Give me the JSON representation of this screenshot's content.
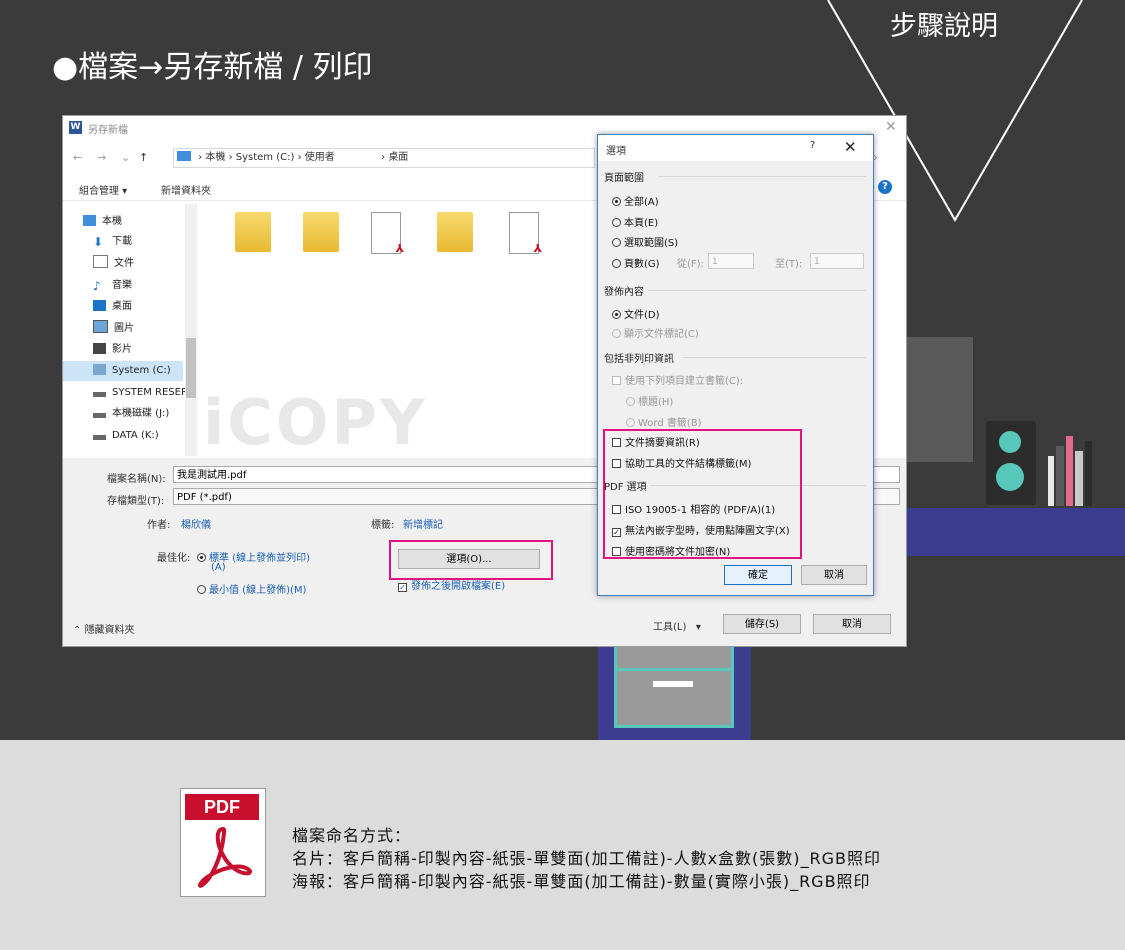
{
  "heading": "●檔案→另存新檔 / 列印",
  "step_label": "步驟說明",
  "save_window": {
    "title": "另存新檔",
    "address": [
      "本機",
      "System (C:)",
      "使用者",
      "桌面"
    ],
    "organize": "組合管理 ▾",
    "new_folder": "新增資料夾",
    "sidebar": [
      "本機",
      "下載",
      "文件",
      "音樂",
      "桌面",
      "圖片",
      "影片",
      "System (C:)",
      "SYSTEM RESERVED",
      "本機磁碟 (J:)",
      "DATA (K:)"
    ],
    "watermark": "iCOPY",
    "filename_label": "檔案名稱(N):",
    "filename_value": "我是測試用.pdf",
    "filetype_label": "存檔類型(T):",
    "filetype_value": "PDF (*.pdf)",
    "author_label": "作者:",
    "author_value": "楊欣儀",
    "tags_label": "標籤:",
    "tags_value": "新增標記",
    "optimize_label": "最佳化:",
    "radio_standard": "標準 (線上發佈並列印)",
    "radio_standard_sub": "(A)",
    "radio_minimum": "最小值 (線上發佈)(M)",
    "options_button": "選項(O)...",
    "open_after": "發佈之後開啟檔案(E)",
    "hide_folders": "隱藏資料夾",
    "tools": "工具(L)",
    "save": "儲存(S)",
    "cancel": "取消"
  },
  "options_dialog": {
    "title": "選項",
    "help": "?",
    "page_range": "頁面範圍",
    "all": "全部(A)",
    "current": "本頁(E)",
    "selection": "選取範圍(S)",
    "pages": "頁數(G)",
    "from_label": "從(F):",
    "from_value": "1",
    "to_label": "至(T):",
    "to_value": "1",
    "publish_what": "發佈內容",
    "document": "文件(D)",
    "show_markup": "顯示文件標記(C)",
    "non_print": "包括非列印資訊",
    "create_bookmarks": "使用下列項目建立書籤(C):",
    "headings": "標題(H)",
    "word_bookmarks": "Word 書籤(B)",
    "doc_properties": "文件摘要資訊(R)",
    "structure_tags": "協助工具的文件結構標籤(M)",
    "pdf_options": "PDF 選項",
    "iso": "ISO 19005-1 相容的 (PDF/A)(1)",
    "bitmap_text": "無法內嵌字型時，使用點陣圖文字(X)",
    "encrypt": "使用密碼將文件加密(N)",
    "ok": "確定",
    "cancel": "取消"
  },
  "naming": {
    "title": "檔案命名方式：",
    "card": "名片：客戶簡稱-印製內容-紙張-單雙面(加工備註)-人數x盒數(張數)_RGB照印",
    "poster": "海報：客戶簡稱-印製內容-紙張-單雙面(加工備註)-數量(實際小張)_RGB照印"
  },
  "pdf_icon_label": "PDF",
  "colors": {
    "highlight": "#e0137f",
    "accent": "#1a73c8",
    "background": "#3b3b3b",
    "panel": "#dcdcdc"
  }
}
